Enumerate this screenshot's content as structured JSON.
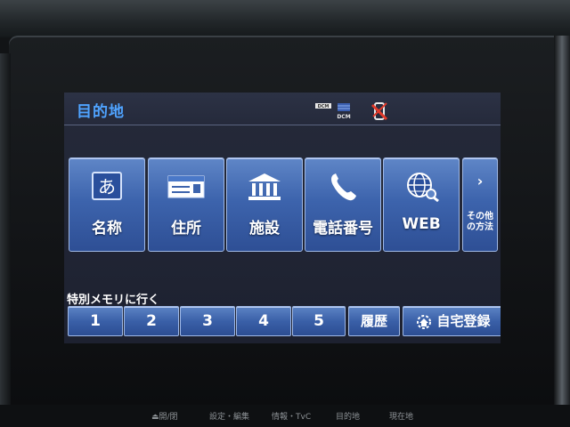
{
  "screen": {
    "title": "目的地",
    "status_icons": [
      "dcm-icon",
      "dcm-icon",
      "phone-disconnected-icon"
    ],
    "status_labels": {
      "dcm_small": "DCM",
      "dcm_large": "DCM"
    }
  },
  "categories": [
    {
      "label": "名称",
      "icon": "hiragana-a-icon"
    },
    {
      "label": "住所",
      "icon": "address-card-icon"
    },
    {
      "label": "施設",
      "icon": "facility-building-icon"
    },
    {
      "label": "電話番号",
      "icon": "phone-icon"
    },
    {
      "label": "WEB",
      "icon": "globe-search-icon"
    }
  ],
  "more": {
    "label_line1": "その他",
    "label_line2": "の方法",
    "icon": "chevron-right-icon"
  },
  "memo": {
    "section_label": "特別メモリに行く",
    "buttons": [
      "1",
      "2",
      "3",
      "4",
      "5"
    ],
    "history_label": "履歴",
    "home_label": "自宅登録"
  },
  "hardware_buttons": [
    "⏏開/閉",
    "設定・編集",
    "情報・TvC",
    "目的地",
    "現在地"
  ],
  "colors": {
    "title": "#4fa3ff",
    "tile": "#3d64ad",
    "screen_bg": "#252a3a"
  }
}
